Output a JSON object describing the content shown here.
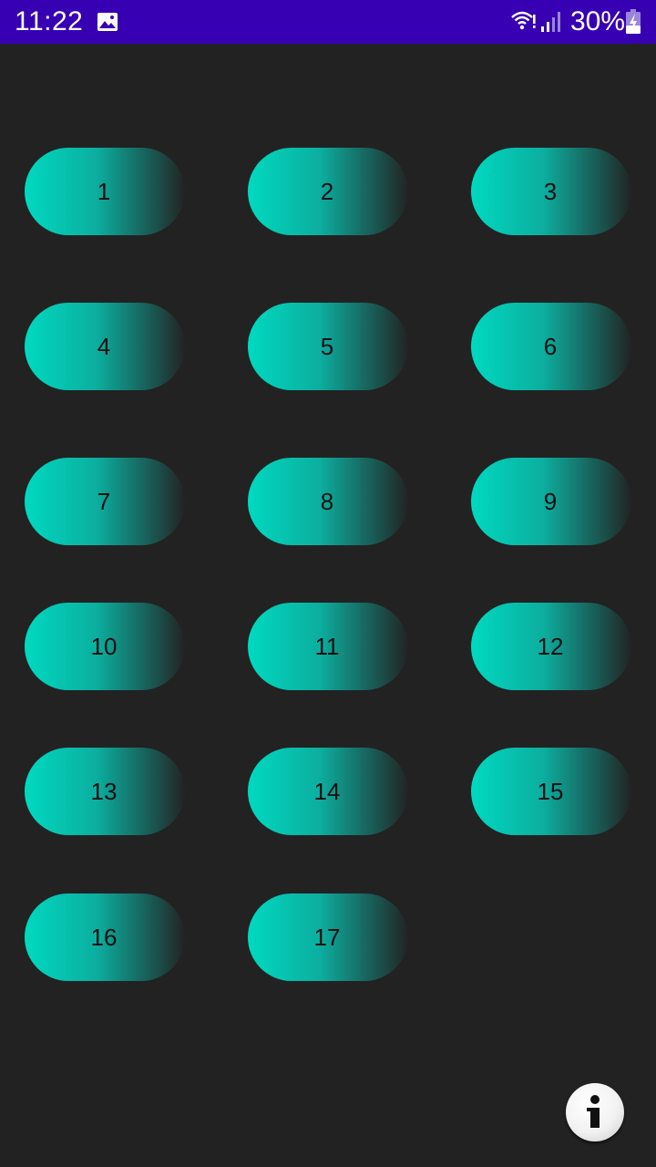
{
  "status_bar": {
    "time": "11:22",
    "battery": "30%",
    "background_color": "#3700b3",
    "icons": [
      "gallery-icon",
      "wifi-icon",
      "cellular-signal-icon",
      "battery-charging-icon"
    ]
  },
  "levels": [
    "1",
    "2",
    "3",
    "4",
    "5",
    "6",
    "7",
    "8",
    "9",
    "10",
    "11",
    "12",
    "13",
    "14",
    "15",
    "16",
    "17"
  ],
  "colors": {
    "background": "#222222",
    "button_gradient_start": "#00d9c0",
    "button_gradient_end": "#232323",
    "button_text": "#111111"
  },
  "info_button": {
    "icon": "info-icon"
  }
}
